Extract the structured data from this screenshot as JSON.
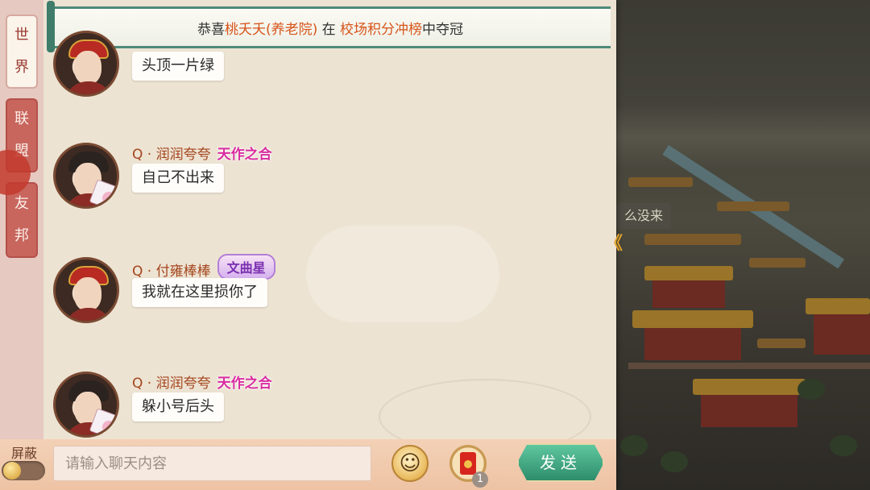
{
  "announcement": {
    "prefix": "恭喜",
    "player": "桃夭夭(养老院)",
    "middle": " 在 ",
    "event": "校场积分冲榜",
    "suffix": "中夺冠"
  },
  "tabs": [
    {
      "chars": [
        "世",
        "界"
      ],
      "active": true
    },
    {
      "chars": [
        "联",
        "盟"
      ],
      "active": false
    },
    {
      "chars": [
        "友",
        "邦"
      ],
      "active": false
    }
  ],
  "messages": [
    {
      "name": "",
      "title": "",
      "text": "头顶一片绿",
      "avatar": "official-red-hat"
    },
    {
      "name": "Q · 润润夸夸",
      "title": "天作之合",
      "text": "自己不出来",
      "avatar": "lady-with-fan"
    },
    {
      "name": "Q · 付雍棒棒",
      "title": "文曲星",
      "text": "我就在这里损你了",
      "avatar": "official-red-hat"
    },
    {
      "name": "Q · 润润夸夸",
      "title": "天作之合",
      "text": "躲小号后头",
      "avatar": "lady-with-fan"
    }
  ],
  "background_peek_text": "么没来",
  "bottom": {
    "mute_label": "屏蔽",
    "mute_on": false,
    "input_placeholder": "请输入聊天内容",
    "redpacket_count": "1",
    "send_label": "发送"
  },
  "colors": {
    "highlight": "#d8541b",
    "title_pink": "#d92ba0",
    "send_green": "#2e8d6b",
    "tab_red": "#c8665e"
  }
}
